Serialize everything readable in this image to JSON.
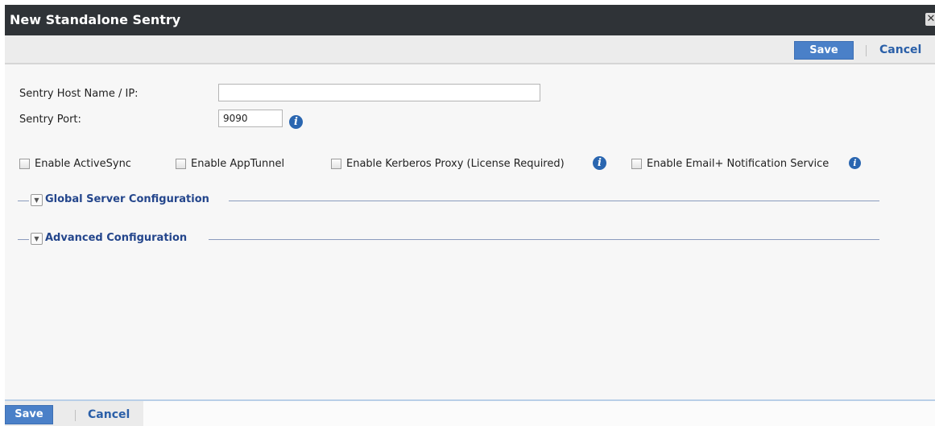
{
  "dialog": {
    "title": "New Standalone Sentry",
    "close_glyph": "✕"
  },
  "toolbar": {
    "save_label": "Save",
    "cancel_label": "Cancel"
  },
  "form": {
    "host_label": "Sentry Host Name / IP:",
    "host_value": "",
    "port_label": "Sentry Port:",
    "port_value": "9090",
    "info_glyph": "i"
  },
  "options": [
    {
      "label": "Enable ActiveSync",
      "checked": false
    },
    {
      "label": "Enable AppTunnel",
      "checked": false
    },
    {
      "label": "Enable Kerberos Proxy (License Required)",
      "checked": false,
      "info": true
    },
    {
      "label": "Enable Email+ Notification Service",
      "checked": false,
      "info": true
    }
  ],
  "sections": [
    {
      "title": "Global Server Configuration",
      "collapsed": true
    },
    {
      "title": "Advanced Configuration",
      "collapsed": true
    }
  ],
  "footer": {
    "save_label": "Save",
    "cancel_label": "Cancel"
  },
  "colors": {
    "accent": "#4a80c8",
    "titlebar": "#2f3337",
    "link": "#2a5fa8",
    "section_title": "#24468c"
  },
  "icons": {
    "info": "info-icon",
    "close": "close-icon",
    "toggle": "chevron-down-icon"
  }
}
